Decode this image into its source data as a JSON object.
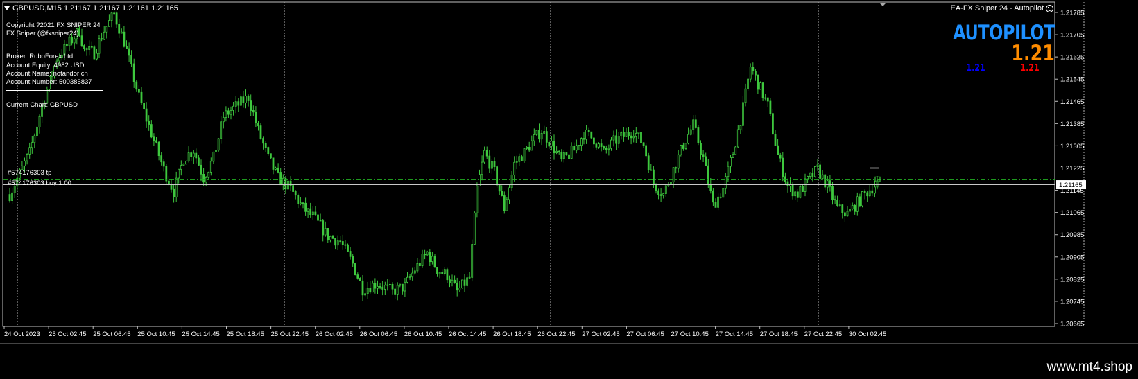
{
  "header": {
    "symbol_text": "GBPUSD,M15  1.21167 1.21167 1.21161 1.21165",
    "ea_title": "EA-FX Sniper 24 - Autopilot"
  },
  "info_panel": {
    "copyright": "Copyright ?2021 FX SNIPER 24",
    "author": "FX Sniper (@fxsniper24)",
    "broker": "Broker: RoboForex Ltd",
    "equity": "Account Equity: 4982 USD",
    "account_name": "Account Name: notandor cn",
    "account_number": "Account Number: 500385837",
    "current_chart": "Current Chart: GBPUSD"
  },
  "autopilot": {
    "label": "AUTOPILOT",
    "value": "1.21",
    "small_blue": "1.21",
    "small_red": "1.21"
  },
  "orders": {
    "tp_label": "#574176303 tp",
    "buy_label": "#574176303 buy 1.00"
  },
  "price_axis": {
    "ticks": [
      {
        "value": 1.21785,
        "label": "1.21785"
      },
      {
        "value": 1.21705,
        "label": "1.21705"
      },
      {
        "value": 1.21625,
        "label": "1.21625"
      },
      {
        "value": 1.21545,
        "label": "1.21545"
      },
      {
        "value": 1.21465,
        "label": "1.21465"
      },
      {
        "value": 1.21385,
        "label": "1.21385"
      },
      {
        "value": 1.21305,
        "label": "1.21305"
      },
      {
        "value": 1.21225,
        "label": "1.21225"
      },
      {
        "value": 1.21145,
        "label": "1.21145"
      },
      {
        "value": 1.21065,
        "label": "1.21065"
      },
      {
        "value": 1.20985,
        "label": "1.20985"
      },
      {
        "value": 1.20905,
        "label": "1.20905"
      },
      {
        "value": 1.20825,
        "label": "1.20825"
      },
      {
        "value": 1.20745,
        "label": "1.20745"
      },
      {
        "value": 1.20665,
        "label": "1.20665"
      }
    ],
    "current_price": 1.21165,
    "current_label": "1.21165",
    "tp_price": 1.21225,
    "entry_price": 1.21183
  },
  "time_axis": {
    "labels": [
      "24 Oct 2023",
      "25 Oct 02:45",
      "25 Oct 06:45",
      "25 Oct 10:45",
      "25 Oct 14:45",
      "25 Oct 18:45",
      "25 Oct 22:45",
      "26 Oct 02:45",
      "26 Oct 06:45",
      "26 Oct 10:45",
      "26 Oct 14:45",
      "26 Oct 18:45",
      "26 Oct 22:45",
      "27 Oct 02:45",
      "27 Oct 06:45",
      "27 Oct 10:45",
      "27 Oct 14:45",
      "27 Oct 18:45",
      "27 Oct 22:45",
      "30 Oct 02:45"
    ]
  },
  "series": {
    "keypoints": [
      [
        0,
        1.2113
      ],
      [
        8,
        1.2128
      ],
      [
        14,
        1.2148
      ],
      [
        19,
        1.2162
      ],
      [
        28,
        1.2172
      ],
      [
        30,
        1.2165
      ],
      [
        34,
        1.2164
      ],
      [
        38,
        1.2172
      ],
      [
        42,
        1.2178
      ],
      [
        46,
        1.2168
      ],
      [
        52,
        1.2148
      ],
      [
        57,
        1.2135
      ],
      [
        62,
        1.2122
      ],
      [
        66,
        1.2114
      ],
      [
        70,
        1.2126
      ],
      [
        74,
        1.2129
      ],
      [
        78,
        1.2119
      ],
      [
        82,
        1.2126
      ],
      [
        86,
        1.2141
      ],
      [
        90,
        1.2144
      ],
      [
        96,
        1.2148
      ],
      [
        100,
        1.2136
      ],
      [
        104,
        1.2126
      ],
      [
        108,
        1.2119
      ],
      [
        113,
        1.2115
      ],
      [
        118,
        1.2108
      ],
      [
        122,
        1.2105
      ],
      [
        128,
        1.2098
      ],
      [
        133,
        1.2096
      ],
      [
        138,
        1.2088
      ],
      [
        142,
        1.2079
      ],
      [
        148,
        1.2081
      ],
      [
        154,
        1.2078
      ],
      [
        159,
        1.208
      ],
      [
        163,
        1.2086
      ],
      [
        168,
        1.2092
      ],
      [
        172,
        1.2086
      ],
      [
        176,
        1.2084
      ],
      [
        180,
        1.2078
      ],
      [
        185,
        1.2083
      ],
      [
        188,
        1.2115
      ],
      [
        191,
        1.2128
      ],
      [
        195,
        1.2121
      ],
      [
        199,
        1.2108
      ],
      [
        203,
        1.2124
      ],
      [
        207,
        1.2128
      ],
      [
        211,
        1.2133
      ],
      [
        214,
        1.2136
      ],
      [
        218,
        1.2131
      ],
      [
        222,
        1.2125
      ],
      [
        227,
        1.2129
      ],
      [
        231,
        1.2135
      ],
      [
        235,
        1.2133
      ],
      [
        239,
        1.2128
      ],
      [
        243,
        1.2132
      ],
      [
        247,
        1.2134
      ],
      [
        251,
        1.2136
      ],
      [
        255,
        1.2131
      ],
      [
        259,
        1.2117
      ],
      [
        263,
        1.2113
      ],
      [
        267,
        1.2122
      ],
      [
        271,
        1.2131
      ],
      [
        275,
        1.2138
      ],
      [
        279,
        1.2126
      ],
      [
        283,
        1.2109
      ],
      [
        287,
        1.2115
      ],
      [
        291,
        1.2128
      ],
      [
        295,
        1.2144
      ],
      [
        298,
        1.2159
      ],
      [
        301,
        1.2153
      ],
      [
        305,
        1.2145
      ],
      [
        309,
        1.2127
      ],
      [
        313,
        1.2116
      ],
      [
        317,
        1.2113
      ],
      [
        321,
        1.2118
      ],
      [
        325,
        1.2122
      ],
      [
        329,
        1.2116
      ],
      [
        333,
        1.2108
      ],
      [
        337,
        1.2106
      ],
      [
        341,
        1.211
      ],
      [
        345,
        1.2114
      ],
      [
        349,
        1.2117
      ]
    ],
    "candle_count": 350
  }
}
